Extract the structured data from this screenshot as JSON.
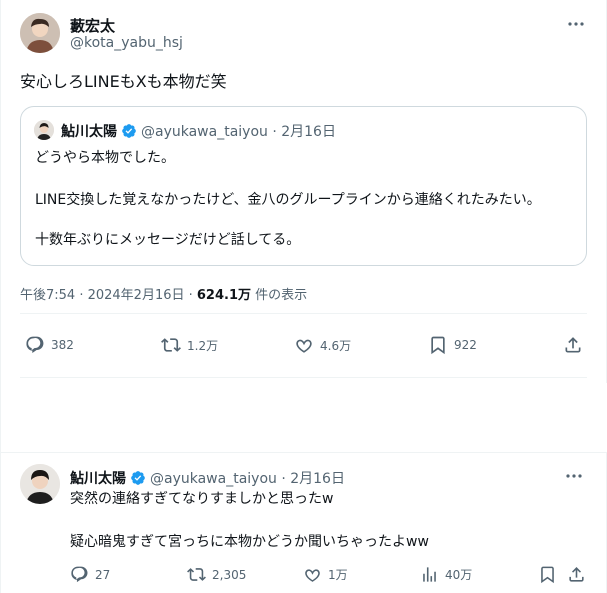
{
  "main_tweet": {
    "author": {
      "name": "藪宏太",
      "handle": "@kota_yabu_hsj"
    },
    "text": "安心しろLINEもXも本物だ笑",
    "quote": {
      "name": "鮎川太陽",
      "handle": "@ayukawa_taiyou",
      "date": "· 2月16日",
      "lines": [
        "どうやら本物でした。",
        "LINE交換した覚えなかったけど、金八のグループラインから連絡くれたみたい。",
        "十数年ぶりにメッセージだけど話してる。"
      ]
    },
    "time": "午後7:54 · 2024年2月16日 · ",
    "views_value": "624.1万",
    "views_label": " 件の表示",
    "actions": {
      "replies": "382",
      "retweets": "1.2万",
      "likes": "4.6万",
      "bookmarks": "922"
    }
  },
  "reply_tweet": {
    "name": "鮎川太陽",
    "handle": "@ayukawa_taiyou",
    "date": "· 2月16日",
    "lines": [
      "突然の連絡すぎてなりすましかと思ったw",
      "疑心暗鬼すぎて宮っちに本物かどうか聞いちゃったよww"
    ],
    "actions": {
      "replies": "27",
      "retweets": "2,305",
      "likes": "1万",
      "views": "40万"
    }
  },
  "colors": {
    "text": "#0f1419",
    "muted": "#536471",
    "verified": "#1d9bf0",
    "border": "#cfd9de",
    "divider": "#eff3f4"
  },
  "icons": [
    "more-icon",
    "verified-badge-icon",
    "reply-icon",
    "retweet-icon",
    "like-icon",
    "bookmark-icon",
    "share-icon",
    "views-icon"
  ]
}
